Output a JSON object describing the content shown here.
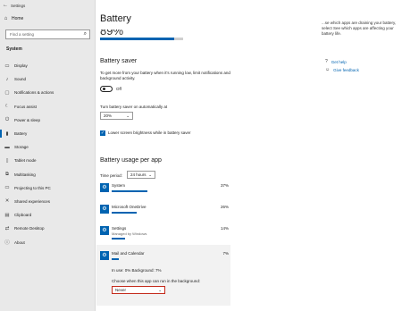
{
  "window": {
    "title": "Settings"
  },
  "sidebar": {
    "home": "Home",
    "search_placeholder": "Find a setting",
    "section": "System",
    "items": [
      {
        "label": "Display",
        "icon": "display-icon",
        "glyph": "▭"
      },
      {
        "label": "Sound",
        "icon": "sound-icon",
        "glyph": "♪"
      },
      {
        "label": "Notifications & actions",
        "icon": "notifications-icon",
        "glyph": "▢"
      },
      {
        "label": "Focus assist",
        "icon": "focus-assist-icon",
        "glyph": "☾"
      },
      {
        "label": "Power & sleep",
        "icon": "power-icon",
        "glyph": "⏻"
      },
      {
        "label": "Battery",
        "icon": "battery-icon",
        "glyph": "▮"
      },
      {
        "label": "Storage",
        "icon": "storage-icon",
        "glyph": "▬"
      },
      {
        "label": "Tablet mode",
        "icon": "tablet-icon",
        "glyph": "▯"
      },
      {
        "label": "Multitasking",
        "icon": "multitasking-icon",
        "glyph": "⧉"
      },
      {
        "label": "Projecting to this PC",
        "icon": "projecting-icon",
        "glyph": "▭"
      },
      {
        "label": "Shared experiences",
        "icon": "shared-experiences-icon",
        "glyph": "✕"
      },
      {
        "label": "Clipboard",
        "icon": "clipboard-icon",
        "glyph": "▤"
      },
      {
        "label": "Remote Desktop",
        "icon": "remote-desktop-icon",
        "glyph": "⇄"
      },
      {
        "label": "About",
        "icon": "about-icon",
        "glyph": "ⓘ"
      }
    ],
    "active_index": 5
  },
  "main": {
    "title": "Battery",
    "percent": "89%",
    "battery_level": 0.89,
    "saver": {
      "heading": "Battery saver",
      "description": "To get more from your battery when it's running low, limit notifications and background activity.",
      "toggle_state": "Off",
      "auto_label": "Turn battery saver on automatically at",
      "auto_value": "20%",
      "brightness_label": "Lower screen brightness while in battery saver"
    },
    "usage": {
      "heading": "Battery usage per app",
      "period_label": "Time period:",
      "period_value": "24 hours",
      "apps": [
        {
          "name": "System",
          "sub": "",
          "percent": "37%",
          "share": 0.37
        },
        {
          "name": "Microsoft OneDrive",
          "sub": "",
          "percent": "26%",
          "share": 0.26
        },
        {
          "name": "Settings",
          "sub": "Managed by Windows",
          "percent": "14%",
          "share": 0.14
        },
        {
          "name": "Mail and Calendar",
          "sub": "",
          "percent": "7%",
          "share": 0.07
        }
      ],
      "detail_usage": "In use: 0%  Background: 7%",
      "detail_choose": "Choose when this app can run in the background:",
      "detail_value": "Never"
    }
  },
  "right": {
    "description": "...se which apps are draining your battery, select See which apps are affecting your battery life.",
    "links": [
      {
        "label": "Get help",
        "icon": "help-icon",
        "glyph": "?"
      },
      {
        "label": "Give feedback",
        "icon": "feedback-icon",
        "glyph": "☺"
      }
    ]
  },
  "colors": {
    "accent": "#0063b1",
    "sidebar_bg": "#e9e9e9",
    "highlight_border": "#c42b1c"
  }
}
